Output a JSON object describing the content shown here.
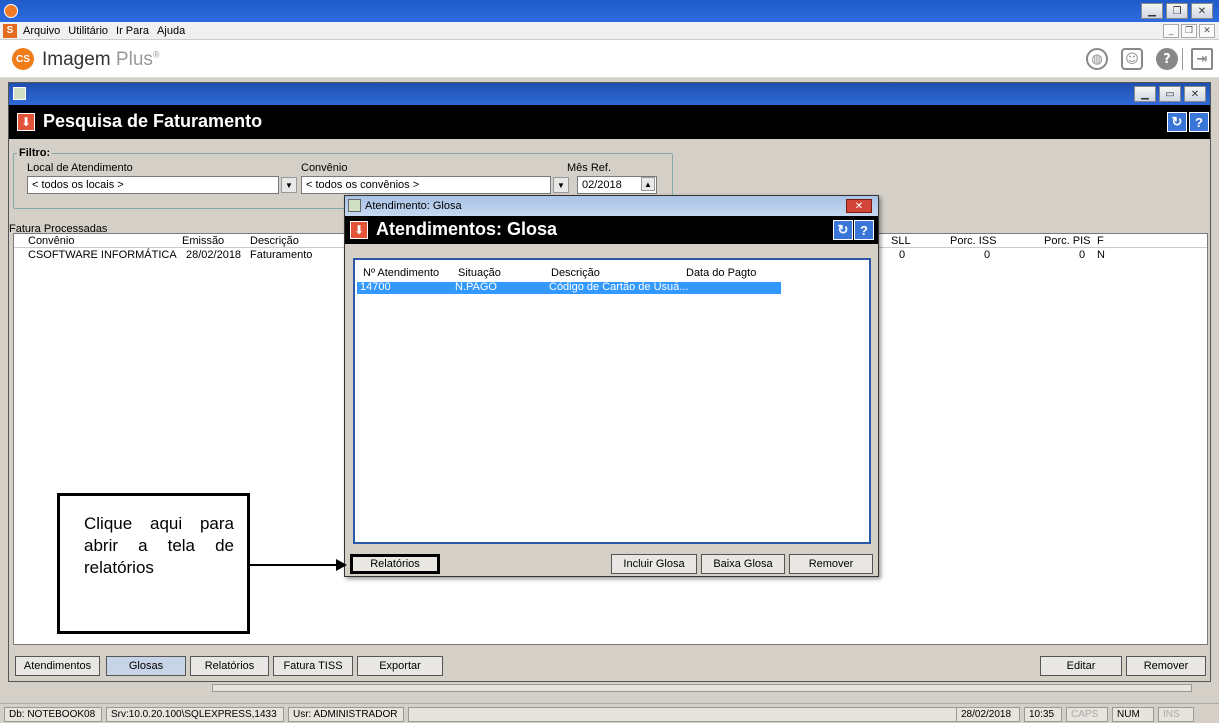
{
  "menu": [
    "Arquivo",
    "Utilitário",
    "Ir Para",
    "Ajuda"
  ],
  "brand": {
    "name": "Imagem",
    "plus": "Plus",
    "mark": "®",
    "logo": "CS"
  },
  "page": {
    "title": "Pesquisa de Faturamento",
    "filter_label": "Filtro:",
    "local_label": "Local de Atendimento",
    "local_value": "< todos os locais >",
    "convenio_label": "Convênio",
    "convenio_value": "< todos os convênios >",
    "mes_label": "Mês Ref.",
    "mes_value": "02/2018",
    "fatura_label": "Fatura Processadas"
  },
  "grid": {
    "headers": [
      "Convênio",
      "Emissão",
      "Descrição",
      "SLL",
      "Porc. ISS",
      "Porc. PIS",
      "F"
    ],
    "row": [
      "CSOFTWARE INFORMÁTICA",
      "28/02/2018",
      "Faturamento",
      "0",
      "0",
      "0",
      "N"
    ]
  },
  "bottom_buttons": [
    "Atendimentos",
    "Glosas",
    "Relatórios",
    "Fatura TISS",
    "Exportar",
    "Editar",
    "Remover"
  ],
  "dialog": {
    "window_title": "Atendimento: Glosa",
    "title": "Atendimentos: Glosa",
    "headers": [
      "Nº Atendimento",
      "Situação",
      "Descrição",
      "Data do Pagto"
    ],
    "row": [
      "14700",
      "N.PAGO",
      "Código de Cartão de Usuá...",
      ""
    ],
    "buttons": [
      "Relatórios",
      "Incluir Glosa",
      "Baixa Glosa",
      "Remover"
    ]
  },
  "callout": "Clique aqui para abrir a tela de relatórios",
  "status": {
    "db": "Db: NOTEBOOK08",
    "srv": "Srv:10.0.20.100\\SQLEXPRESS,1433",
    "usr": "Usr: ADMINISTRADOR",
    "date": "28/02/2018",
    "time": "10:35",
    "caps": "CAPS",
    "num": "NUM",
    "ins": "INS"
  },
  "colors": {
    "selection": "#3399ff",
    "header_bg": "#000000",
    "accent": "#e2533a"
  }
}
